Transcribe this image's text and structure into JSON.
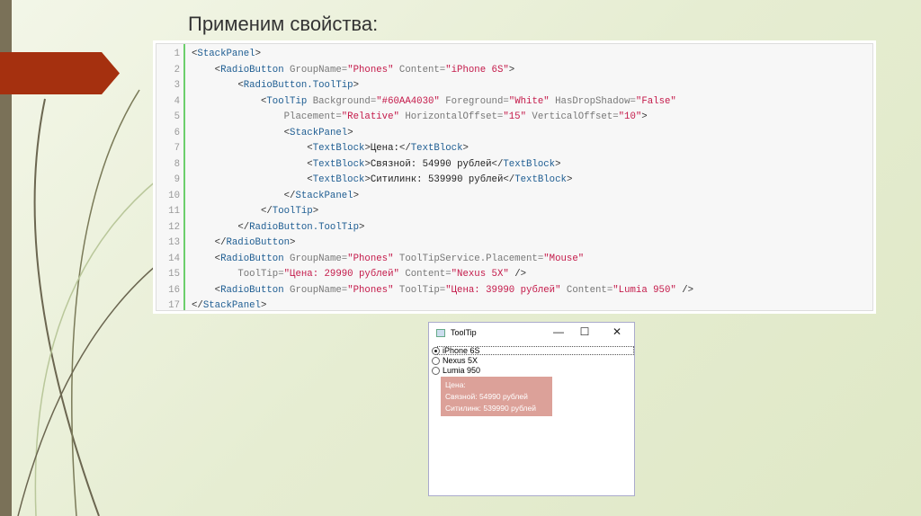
{
  "slide": {
    "title": "Применим свойства:",
    "accent": "#a5300f"
  },
  "code": {
    "lines": [
      [
        [
          "b",
          "<"
        ],
        [
          "t",
          "StackPanel"
        ],
        [
          "b",
          ">"
        ]
      ],
      [
        [
          "p",
          "    "
        ],
        [
          "b",
          "<"
        ],
        [
          "t",
          "RadioButton "
        ],
        [
          "a",
          "GroupName="
        ],
        [
          "v",
          "\"Phones\""
        ],
        [
          "a",
          " Content="
        ],
        [
          "v",
          "\"iPhone 6S\""
        ],
        [
          "b",
          ">"
        ]
      ],
      [
        [
          "p",
          "        "
        ],
        [
          "b",
          "<"
        ],
        [
          "t",
          "RadioButton.ToolTip"
        ],
        [
          "b",
          ">"
        ]
      ],
      [
        [
          "p",
          "            "
        ],
        [
          "b",
          "<"
        ],
        [
          "t",
          "ToolTip "
        ],
        [
          "a",
          "Background="
        ],
        [
          "v",
          "\"#60AA4030\""
        ],
        [
          "a",
          " Foreground="
        ],
        [
          "v",
          "\"White\""
        ],
        [
          "a",
          " HasDropShadow="
        ],
        [
          "v",
          "\"False\""
        ]
      ],
      [
        [
          "p",
          "                "
        ],
        [
          "a",
          "Placement="
        ],
        [
          "v",
          "\"Relative\""
        ],
        [
          "a",
          " HorizontalOffset="
        ],
        [
          "v",
          "\"15\""
        ],
        [
          "a",
          " VerticalOffset="
        ],
        [
          "v",
          "\"10\""
        ],
        [
          "b",
          ">"
        ]
      ],
      [
        [
          "p",
          "                "
        ],
        [
          "b",
          "<"
        ],
        [
          "t",
          "StackPanel"
        ],
        [
          "b",
          ">"
        ]
      ],
      [
        [
          "p",
          "                    "
        ],
        [
          "b",
          "<"
        ],
        [
          "t",
          "TextBlock"
        ],
        [
          "b",
          ">"
        ],
        [
          "p",
          "Цена:"
        ],
        [
          "b",
          "</"
        ],
        [
          "t",
          "TextBlock"
        ],
        [
          "b",
          ">"
        ]
      ],
      [
        [
          "p",
          "                    "
        ],
        [
          "b",
          "<"
        ],
        [
          "t",
          "TextBlock"
        ],
        [
          "b",
          ">"
        ],
        [
          "p",
          "Связной: 54990 рублей"
        ],
        [
          "b",
          "</"
        ],
        [
          "t",
          "TextBlock"
        ],
        [
          "b",
          ">"
        ]
      ],
      [
        [
          "p",
          "                    "
        ],
        [
          "b",
          "<"
        ],
        [
          "t",
          "TextBlock"
        ],
        [
          "b",
          ">"
        ],
        [
          "p",
          "Ситилинк: 539990 рублей"
        ],
        [
          "b",
          "</"
        ],
        [
          "t",
          "TextBlock"
        ],
        [
          "b",
          ">"
        ]
      ],
      [
        [
          "p",
          "                "
        ],
        [
          "b",
          "</"
        ],
        [
          "t",
          "StackPanel"
        ],
        [
          "b",
          ">"
        ]
      ],
      [
        [
          "p",
          "            "
        ],
        [
          "b",
          "</"
        ],
        [
          "t",
          "ToolTip"
        ],
        [
          "b",
          ">"
        ]
      ],
      [
        [
          "p",
          "        "
        ],
        [
          "b",
          "</"
        ],
        [
          "t",
          "RadioButton.ToolTip"
        ],
        [
          "b",
          ">"
        ]
      ],
      [
        [
          "p",
          "    "
        ],
        [
          "b",
          "</"
        ],
        [
          "t",
          "RadioButton"
        ],
        [
          "b",
          ">"
        ]
      ],
      [
        [
          "p",
          "    "
        ],
        [
          "b",
          "<"
        ],
        [
          "t",
          "RadioButton "
        ],
        [
          "a",
          "GroupName="
        ],
        [
          "v",
          "\"Phones\""
        ],
        [
          "a",
          " ToolTipService.Placement="
        ],
        [
          "v",
          "\"Mouse\""
        ]
      ],
      [
        [
          "p",
          "        "
        ],
        [
          "a",
          "ToolTip="
        ],
        [
          "v",
          "\"Цена: 29990 рублей\""
        ],
        [
          "a",
          " Content="
        ],
        [
          "v",
          "\"Nexus 5X\""
        ],
        [
          "b",
          " />"
        ]
      ],
      [
        [
          "p",
          "    "
        ],
        [
          "b",
          "<"
        ],
        [
          "t",
          "RadioButton "
        ],
        [
          "a",
          "GroupName="
        ],
        [
          "v",
          "\"Phones\""
        ],
        [
          "a",
          " ToolTip="
        ],
        [
          "v",
          "\"Цена: 39990 рублей\""
        ],
        [
          "a",
          " Content="
        ],
        [
          "v",
          "\"Lumia 950\""
        ],
        [
          "b",
          " />"
        ]
      ],
      [
        [
          "b",
          "</"
        ],
        [
          "t",
          "StackPanel"
        ],
        [
          "b",
          ">"
        ]
      ]
    ]
  },
  "window": {
    "title": "ToolTip",
    "minimize": "—",
    "maximize": "☐",
    "close": "✕",
    "radios": [
      {
        "label": "iPhone 6S",
        "checked": true
      },
      {
        "label": "Nexus 5X",
        "checked": false
      },
      {
        "label": "Lumia 950",
        "checked": false
      }
    ],
    "tooltip": {
      "lines": [
        "Цена:",
        "Связной: 54990 рублей",
        "Ситилинк: 539990 рублей"
      ],
      "background": "#60AA4030"
    }
  }
}
